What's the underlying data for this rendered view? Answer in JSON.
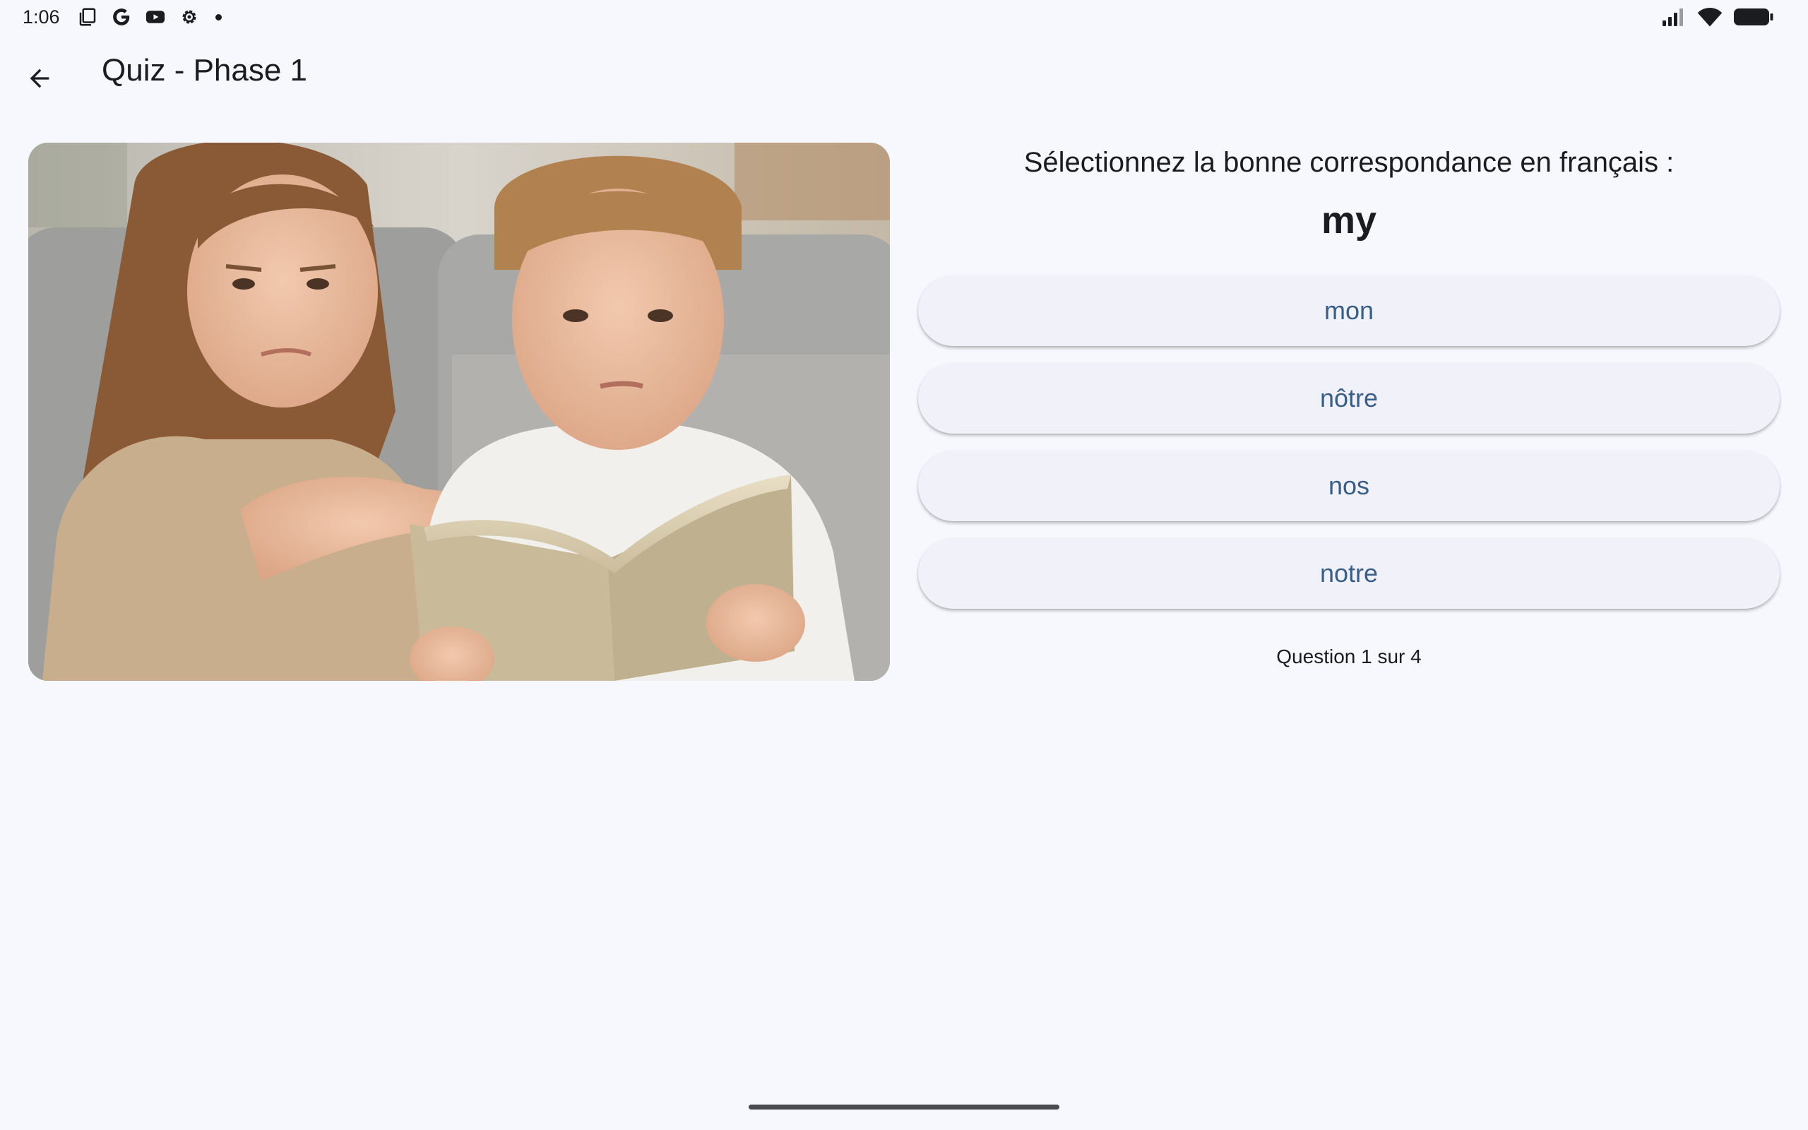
{
  "status_bar": {
    "time": "1:06",
    "left_icons": [
      "copy-icon",
      "google-icon",
      "youtube-icon",
      "settings-gear-icon",
      "notification-dot-icon"
    ],
    "right_icons": [
      "cellular-signal-icon",
      "wifi-icon",
      "battery-icon"
    ]
  },
  "app_bar": {
    "back_icon": "arrow-back-icon",
    "title": "Quiz - Phase 1"
  },
  "illustration": {
    "subject": "two children reading a book on a sofa"
  },
  "question": {
    "instruction": "Sélectionnez la bonne correspondance en français :",
    "word": "my",
    "options": [
      "mon",
      "nôtre",
      "nos",
      "notre"
    ],
    "progress": "Question 1 sur 4",
    "current": 1,
    "total": 4
  },
  "colors": {
    "background": "#f7f8fd",
    "option_background": "#f1f2f9",
    "option_text": "#3a5d86",
    "text": "#1b1c20"
  }
}
